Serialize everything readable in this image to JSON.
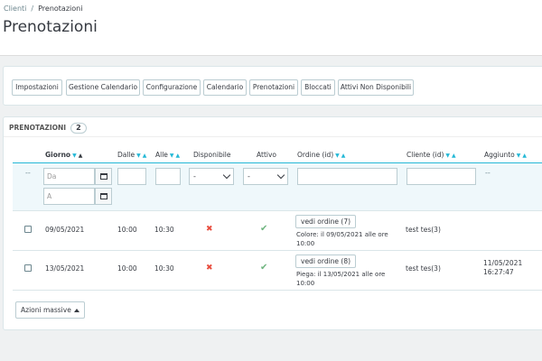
{
  "breadcrumb": {
    "parent": "Clienti",
    "separator": "/",
    "current": "Prenotazioni"
  },
  "page_title": "Prenotazioni",
  "toolbar": {
    "buttons": [
      "Impostazioni",
      "Gestione Calendario",
      "Configurazione",
      "Calendario",
      "Prenotazioni",
      "Bloccati",
      "Attivi Non Disponibili"
    ]
  },
  "list": {
    "heading": "PRENOTAZIONI",
    "count": "2",
    "columns": {
      "giorno": "Giorno",
      "dalle": "Dalle",
      "alle": "Alle",
      "disponibile": "Disponibile",
      "attivo": "Attivo",
      "ordine": "Ordine (id)",
      "cliente": "Cliente (id)",
      "aggiunto": "Aggiunto"
    },
    "filters": {
      "dash": "--",
      "date_from_placeholder": "Da",
      "date_to_placeholder": "A",
      "disponibile_value": "-",
      "attivo_value": "-",
      "aggiunto_dash": "--"
    },
    "rows": [
      {
        "giorno": "09/05/2021",
        "dalle": "10:00",
        "alle": "10:30",
        "disponibile": "no",
        "attivo": "yes",
        "order_button": "vedi ordine (7)",
        "order_note": "Colore: il 09/05/2021 alle ore 10:00",
        "cliente": "test tes(3)",
        "aggiunto": ""
      },
      {
        "giorno": "13/05/2021",
        "dalle": "10:00",
        "alle": "10:30",
        "disponibile": "no",
        "attivo": "yes",
        "order_button": "vedi ordine (8)",
        "order_note": "Piega: il 13/05/2021 alle ore 10:00",
        "cliente": "test tes(3)",
        "aggiunto": "11/05/2021 16:27:47"
      }
    ],
    "bulk_actions": "Azioni massive"
  },
  "icons": {
    "no": "cross-icon",
    "yes": "check-icon",
    "calendar": "calendar-icon"
  },
  "colors": {
    "accent": "#25b9d7",
    "no": "#e84c3d",
    "yes": "#70b580"
  }
}
